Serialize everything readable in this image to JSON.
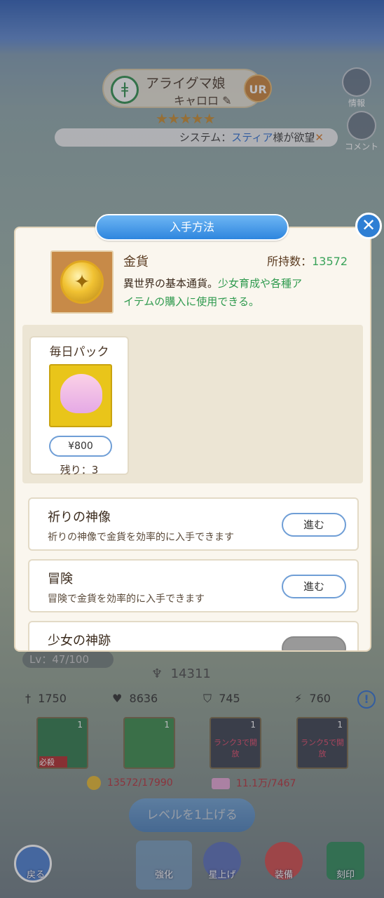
{
  "header": {
    "title": "アライグマ娘",
    "subtitle": "キャロロ",
    "rarity": "UR",
    "stars": "★★★★★",
    "system_prefix": "システム：",
    "system_name": "スティア",
    "system_suffix": "様が欲望",
    "info_label": "情報",
    "comment_label": "コメント"
  },
  "modal": {
    "tab_title": "入手方法",
    "item_name": "金貨",
    "owned_label": "所持数：",
    "owned_value": "13572",
    "desc_1": "異世界の基本通貨。",
    "desc_2": "少女育成や各種ア",
    "desc_3": "イテムの購入に使用できる。",
    "pack": {
      "title": "毎日パック",
      "price": "¥800",
      "remaining": "残り：3"
    },
    "sources": [
      {
        "title": "祈りの神像",
        "desc": "祈りの神像で金貨を効率的に入手できます",
        "button": "進む"
      },
      {
        "title": "冒険",
        "desc": "冒険で金貨を効率的に入手できます",
        "button": "進む"
      },
      {
        "title": "少女の神跡",
        "desc": "",
        "button": ""
      }
    ]
  },
  "character": {
    "level": "Lv：47/100",
    "power": "14311",
    "stats": [
      "1750",
      "8636",
      "745",
      "760"
    ],
    "skills": [
      {
        "count": "1",
        "label": "必殺"
      },
      {
        "count": "1",
        "label": ""
      },
      {
        "count": "1",
        "label": "ランク3で開放"
      },
      {
        "count": "1",
        "label": "ランク5で開放"
      }
    ],
    "gold": "13572/17990",
    "material": "11.1万/7467",
    "levelup": "レベルを1上げる"
  },
  "nav": {
    "back": "戻る",
    "tabs": [
      "強化",
      "星上げ",
      "装備",
      "刻印"
    ]
  },
  "colors": {
    "accent_blue": "#2e86de",
    "green": "#2f9a4e",
    "gold": "#f1c232"
  }
}
